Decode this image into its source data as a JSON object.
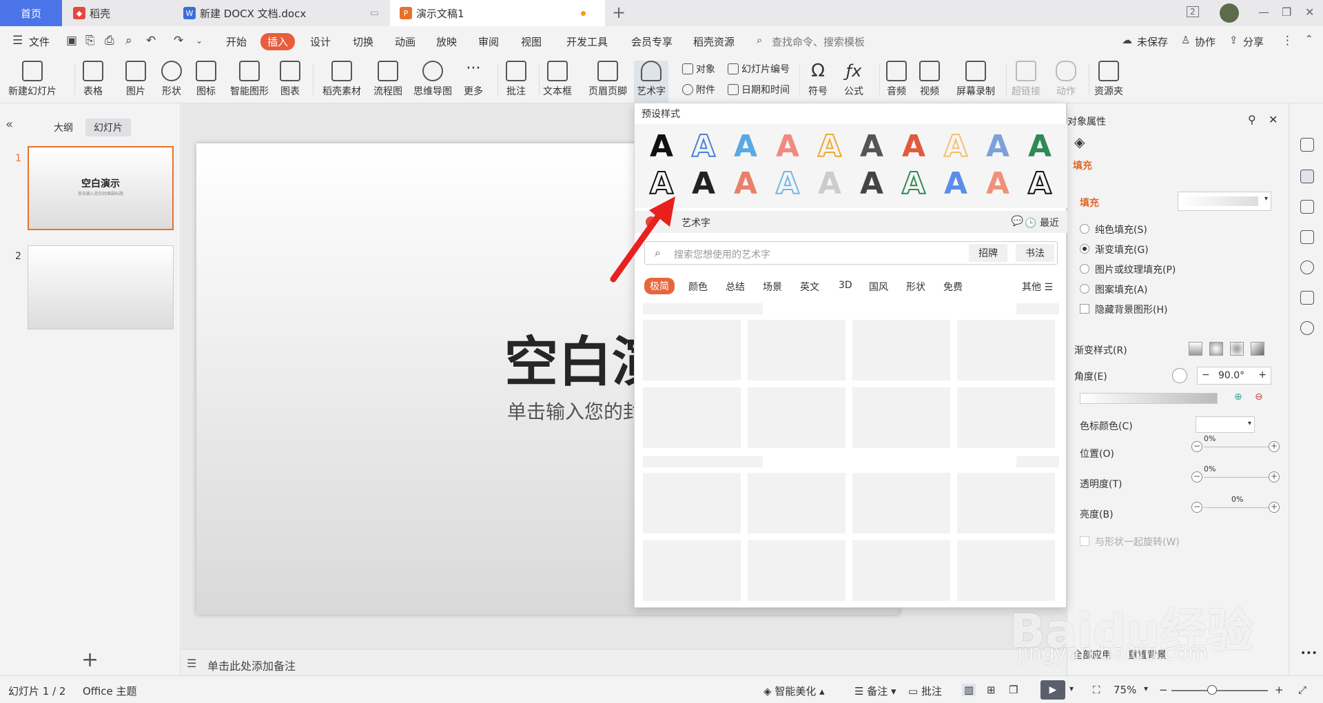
{
  "tabs": [
    {
      "label": "首页"
    },
    {
      "label": "稻壳"
    },
    {
      "label": "新建 DOCX 文档.docx"
    },
    {
      "label": "演示文稿1"
    }
  ],
  "window": {
    "badge": "2"
  },
  "menu": {
    "file": "文件",
    "items": [
      "开始",
      "插入",
      "设计",
      "切换",
      "动画",
      "放映",
      "审阅",
      "视图",
      "开发工具",
      "会员专享",
      "稻壳资源"
    ],
    "search_placeholder": "查找命令、搜索模板",
    "unsaved": "未保存",
    "collab": "协作",
    "share": "分享"
  },
  "ribbon": {
    "new_slide": "新建幻灯片",
    "table": "表格",
    "picture": "图片",
    "shape": "形状",
    "icon": "图标",
    "smart_shape": "智能图形",
    "chart": "图表",
    "daoke_material": "稻壳素材",
    "flowchart": "流程图",
    "mindmap": "思维导图",
    "more": "更多",
    "comment": "批注",
    "textbox": "文本框",
    "header_footer": "页眉页脚",
    "wordart": "艺术字",
    "object": "对象",
    "attachment": "附件",
    "slide_number": "幻灯片编号",
    "datetime": "日期和时间",
    "symbol": "符号",
    "formula": "公式",
    "audio": "音频",
    "video": "视频",
    "screen_record": "屏幕录制",
    "hyperlink": "超链接",
    "action": "动作",
    "resource": "资源夹"
  },
  "left_panel": {
    "tab_outline": "大纲",
    "tab_slides": "幻灯片",
    "slides": [
      {
        "num": "1",
        "title": "空白演示",
        "sub": "单击输入您的封面副标题"
      },
      {
        "num": "2",
        "title": "",
        "sub": ""
      }
    ]
  },
  "slide": {
    "title": "空白演",
    "subtitle": "单击输入您的封"
  },
  "notes": {
    "placeholder": "单击此处添加备注"
  },
  "popup": {
    "heading": "预设样式",
    "section_label": "艺术字",
    "recent": "最近",
    "search_placeholder": "搜索您想使用的艺术字",
    "btn_zhaopai": "招牌",
    "btn_shufa": "书法",
    "categories": [
      "极简",
      "颜色",
      "总结",
      "场景",
      "英文",
      "3D",
      "国风",
      "形状",
      "免费"
    ],
    "other": "其他",
    "glyph": "A",
    "preset_colors_row1": [
      "#111111",
      "#4a7fd8",
      "#5aa9e0",
      "#f08a80",
      "#f0a830",
      "#555555",
      "#e05a40",
      "#f4c070",
      "#7ea0d8",
      "#2f8a55"
    ],
    "preset_colors_row2": [
      "#111111",
      "#222222",
      "#e8806a",
      "#70b8e8",
      "#cccccc",
      "#444444",
      "#2f8a55",
      "#5b8ee8",
      "#f0907a",
      "#111111"
    ]
  },
  "props": {
    "title": "对象属性",
    "fill_tab": "填充",
    "fill_section": "填充",
    "options": [
      "纯色填充(S)",
      "渐变填充(G)",
      "图片或纹理填充(P)",
      "图案填充(A)"
    ],
    "hide_bg": "隐藏背景图形(H)",
    "gradient_style": "渐变样式(R)",
    "angle": "角度(E)",
    "angle_value": "90.0°",
    "stop_color": "色标颜色(C)",
    "position": "位置(O)",
    "position_value": "0%",
    "transparency": "透明度(T)",
    "transparency_value": "0%",
    "brightness": "亮度(B)",
    "brightness_value": "0%",
    "rotate_with_shape": "与形状一起旋转(W)",
    "apply_all": "全部应用",
    "reset_bg": "重置背景"
  },
  "status": {
    "slide_count": "幻灯片 1 / 2",
    "theme": "Office 主题",
    "smart_beautify": "智能美化",
    "notes": "备注",
    "comments": "批注",
    "zoom": "75%"
  },
  "watermark": {
    "brand": "Baidu经验",
    "url": "jingyan.baidu.com"
  }
}
